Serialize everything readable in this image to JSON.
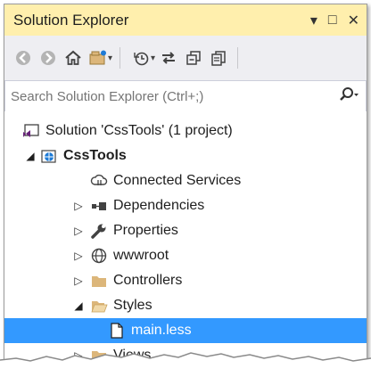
{
  "window": {
    "title": "Solution Explorer",
    "title_icons": [
      "dropdown-icon",
      "maximize-icon",
      "close-icon"
    ]
  },
  "toolbar": {
    "buttons": [
      "back-icon",
      "forward-icon",
      "home-icon",
      "switch-views-icon",
      "pending-changes-icon",
      "sync-icon",
      "collapse-all-icon",
      "show-all-files-icon"
    ]
  },
  "search": {
    "placeholder": "Search Solution Explorer (Ctrl+;)"
  },
  "tree": {
    "items": [
      {
        "label": "Solution 'CssTools' (1 project)",
        "icon": "solution-icon"
      },
      {
        "label": "CssTools",
        "icon": "web-project-icon",
        "expanded": true
      },
      {
        "label": "Connected Services",
        "icon": "connected-services-icon"
      },
      {
        "label": "Dependencies",
        "icon": "dependencies-icon"
      },
      {
        "label": "Properties",
        "icon": "wrench-icon"
      },
      {
        "label": "wwwroot",
        "icon": "globe-icon"
      },
      {
        "label": "Controllers",
        "icon": "folder-icon"
      },
      {
        "label": "Styles",
        "icon": "open-folder-icon",
        "expanded": true
      },
      {
        "label": "main.less",
        "icon": "file-icon",
        "selected": true
      },
      {
        "label": "Views",
        "icon": "folder-icon"
      }
    ]
  },
  "colors": {
    "title_bar": "#ffefad",
    "selection": "#3399ff",
    "folder": "#dcb67a",
    "project_blue": "#1e7bd6",
    "solution_purple": "#68217a"
  }
}
